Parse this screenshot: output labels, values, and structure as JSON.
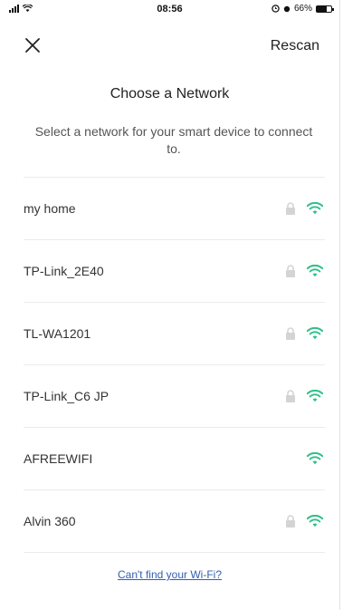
{
  "status_bar": {
    "time": "08:56",
    "battery_text": "66%",
    "battery_level": 0.66
  },
  "header": {
    "close_icon": "close-icon",
    "rescan_label": "Rescan"
  },
  "title": "Choose a Network",
  "subtitle": "Select a network for your smart device to connect to.",
  "networks": [
    {
      "ssid": "my home",
      "secured": true
    },
    {
      "ssid": "TP-Link_2E40",
      "secured": true
    },
    {
      "ssid": "TL-WA1201",
      "secured": true
    },
    {
      "ssid": "TP-Link_C6 JP",
      "secured": true
    },
    {
      "ssid": "AFREEWIFI",
      "secured": false
    },
    {
      "ssid": "Alvin 360",
      "secured": true
    }
  ],
  "help_link": "Can't find your Wi-Fi?",
  "colors": {
    "wifi": "#2fbf8a",
    "lock": "#d4d4d4",
    "link": "#2f5fb3"
  }
}
